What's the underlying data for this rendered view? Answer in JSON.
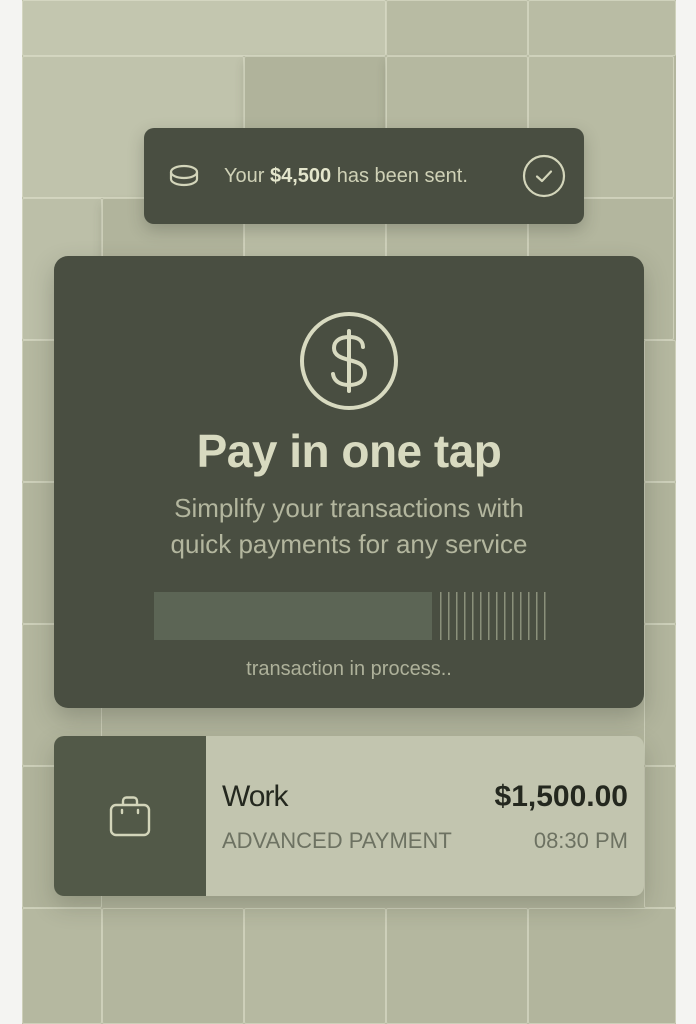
{
  "notification": {
    "prefix": "Your ",
    "amount": "$4,500",
    "suffix": " has been sent.",
    "leading_icon": "coin-icon",
    "trailing_icon": "check-circle-icon"
  },
  "hero": {
    "icon": "dollar-circle-icon",
    "title": "Pay in one tap",
    "subtitle_line1": "Simplify your transactions with",
    "subtitle_line2": "quick payments for any service",
    "progress_fraction": 0.71,
    "status": "transaction in process.."
  },
  "transaction": {
    "icon": "briefcase-icon",
    "name": "Work",
    "amount": "$1,500.00",
    "kind": "ADVANCED PAYMENT",
    "time": "08:30 PM"
  },
  "colors": {
    "dark_surface": "#494e41",
    "background": "#b3b69e",
    "light_surface": "#c2c5af",
    "accent_text": "#d8dac0"
  }
}
